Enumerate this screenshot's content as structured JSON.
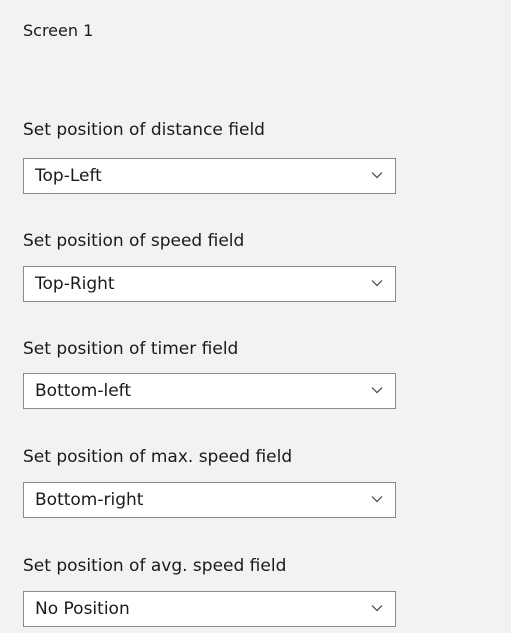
{
  "screen": {
    "title": "Screen 1"
  },
  "fields": [
    {
      "label": "Set position of distance field",
      "selected": "Top-Left",
      "icon": "chevron-down-icon"
    },
    {
      "label": "Set position of speed field",
      "selected": "Top-Right",
      "icon": "chevron-down-icon"
    },
    {
      "label": "Set position of timer field",
      "selected": "Bottom-left",
      "icon": "chevron-down-icon"
    },
    {
      "label": "Set position of max. speed field",
      "selected": "Bottom-right",
      "icon": "chevron-down-icon"
    },
    {
      "label": "Set position of avg. speed field",
      "selected": "No Position",
      "icon": "chevron-down-icon"
    }
  ],
  "colors": {
    "panel_background": "#f2f2f2",
    "dropdown_background": "#ffffff",
    "dropdown_border": "#8a8a8a",
    "text": "#1a1a1a"
  }
}
